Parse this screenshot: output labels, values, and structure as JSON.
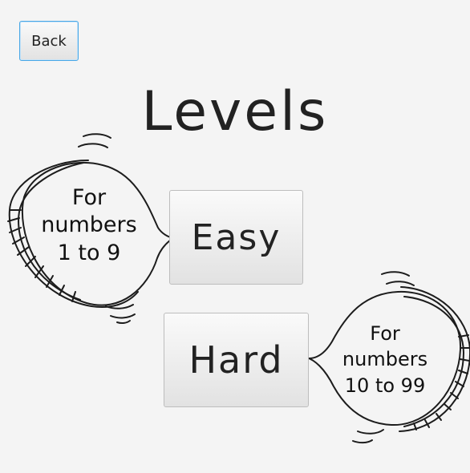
{
  "back_button": {
    "label": "Back"
  },
  "title": "Levels",
  "levels": [
    {
      "label": "Easy",
      "hint_lines": [
        "For",
        "numbers",
        "1 to 9"
      ]
    },
    {
      "label": "Hard",
      "hint_lines": [
        "For",
        "numbers",
        "10 to 99"
      ]
    }
  ],
  "colors": {
    "background": "#f4f4f4",
    "ink": "#222222",
    "focus_border": "#48a7e6"
  }
}
